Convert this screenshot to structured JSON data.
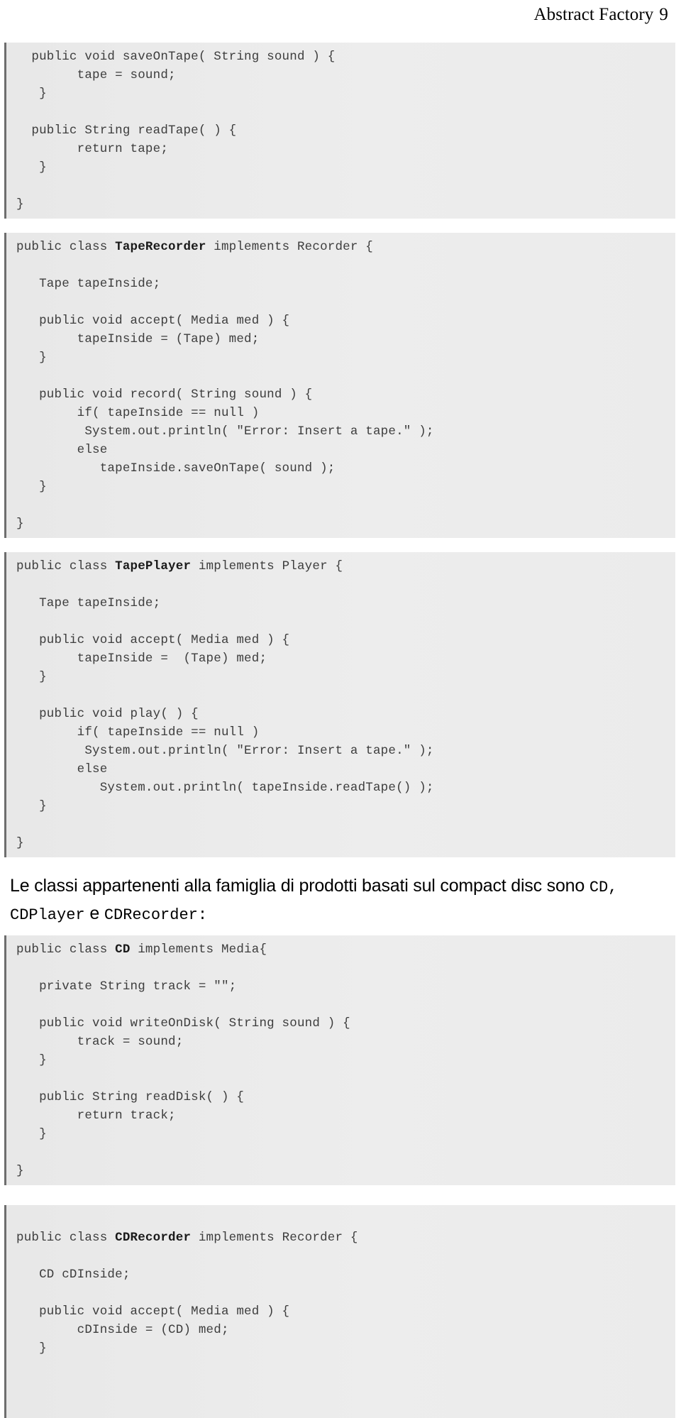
{
  "header": {
    "title": "Abstract Factory",
    "page_number": "9"
  },
  "blocks": [
    {
      "id": "tape-class-tail",
      "lines": [
        {
          "text": "  public void saveOnTape( String sound ) {"
        },
        {
          "text": "        tape = sound;"
        },
        {
          "text": "   }"
        },
        {
          "text": ""
        },
        {
          "text": "  public String readTape( ) {"
        },
        {
          "text": "        return tape;"
        },
        {
          "text": "   }"
        },
        {
          "text": ""
        },
        {
          "text": "}"
        }
      ]
    },
    {
      "id": "tape-recorder-class",
      "lines": [
        {
          "text": "public class ",
          "bold": "TapeRecorder",
          "after": " implements Recorder {"
        },
        {
          "text": ""
        },
        {
          "text": "   Tape tapeInside;"
        },
        {
          "text": ""
        },
        {
          "text": "   public void accept( Media med ) {"
        },
        {
          "text": "        tapeInside = (Tape) med;"
        },
        {
          "text": "   }"
        },
        {
          "text": ""
        },
        {
          "text": "   public void record( String sound ) {"
        },
        {
          "text": "        if( tapeInside == null )"
        },
        {
          "text": "         System.out.println( \"Error: Insert a tape.\" );"
        },
        {
          "text": "        else"
        },
        {
          "text": "           tapeInside.saveOnTape( sound );"
        },
        {
          "text": "   }"
        },
        {
          "text": ""
        },
        {
          "text": "}"
        }
      ]
    },
    {
      "id": "tape-player-class",
      "lines": [
        {
          "text": "public class ",
          "bold": "TapePlayer",
          "after": " implements Player {"
        },
        {
          "text": ""
        },
        {
          "text": "   Tape tapeInside;"
        },
        {
          "text": ""
        },
        {
          "text": "   public void accept( Media med ) {"
        },
        {
          "text": "        tapeInside =  (Tape) med;"
        },
        {
          "text": "   }"
        },
        {
          "text": ""
        },
        {
          "text": "   public void play( ) {"
        },
        {
          "text": "        if( tapeInside == null )"
        },
        {
          "text": "         System.out.println( \"Error: Insert a tape.\" );"
        },
        {
          "text": "        else"
        },
        {
          "text": "           System.out.println( tapeInside.readTape() );"
        },
        {
          "text": "   }"
        },
        {
          "text": ""
        },
        {
          "text": "}"
        }
      ]
    },
    {
      "id": "cd-class",
      "lines": [
        {
          "text": "public class ",
          "bold": "CD",
          "after": " implements Media{"
        },
        {
          "text": ""
        },
        {
          "text": "   private String track = \"\";"
        },
        {
          "text": ""
        },
        {
          "text": "   public void writeOnDisk( String sound ) {"
        },
        {
          "text": "        track = sound;"
        },
        {
          "text": "   }"
        },
        {
          "text": ""
        },
        {
          "text": "   public String readDisk( ) {"
        },
        {
          "text": "        return track;"
        },
        {
          "text": "   }"
        },
        {
          "text": ""
        },
        {
          "text": "}"
        }
      ]
    },
    {
      "id": "cd-recorder-class",
      "lines": [
        {
          "text": ""
        },
        {
          "text": "public class ",
          "bold": "CDRecorder",
          "after": " implements Recorder {"
        },
        {
          "text": ""
        },
        {
          "text": "   CD cDInside;"
        },
        {
          "text": ""
        },
        {
          "text": "   public void accept( Media med ) {"
        },
        {
          "text": "        cDInside = (CD) med;"
        },
        {
          "text": "   }"
        },
        {
          "text": ""
        },
        {
          "text": ""
        },
        {
          "text": ""
        }
      ]
    }
  ],
  "paragraph": {
    "part1": "Le classi appartenenti alla famiglia di prodotti basati sul compact disc sono ",
    "code1": "CD",
    "sep1": ", ",
    "code2": "CDPlayer",
    "sep2": " e ",
    "code3": "CDRecorder",
    "tail": ":"
  }
}
